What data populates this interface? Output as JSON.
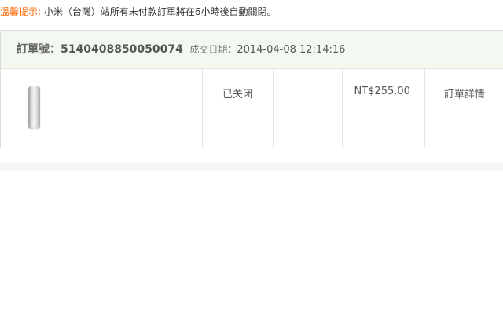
{
  "notice": {
    "label": "溫馨提示:",
    "text": " 小米（台灣）站所有未付款訂單將在6小時後自動關閉。"
  },
  "order": {
    "number_label": "訂單號：",
    "number": "5140408850050074",
    "date_label": "成交日期：",
    "date": "2014-04-08 12:14:16",
    "product_icon": "power-bank-thumbnail",
    "status": "已关闭",
    "price": "NT$255.00",
    "detail_link": "訂單詳情"
  },
  "colors": {
    "accent": "#ff6700",
    "header_bg": "#f3f8f1"
  }
}
